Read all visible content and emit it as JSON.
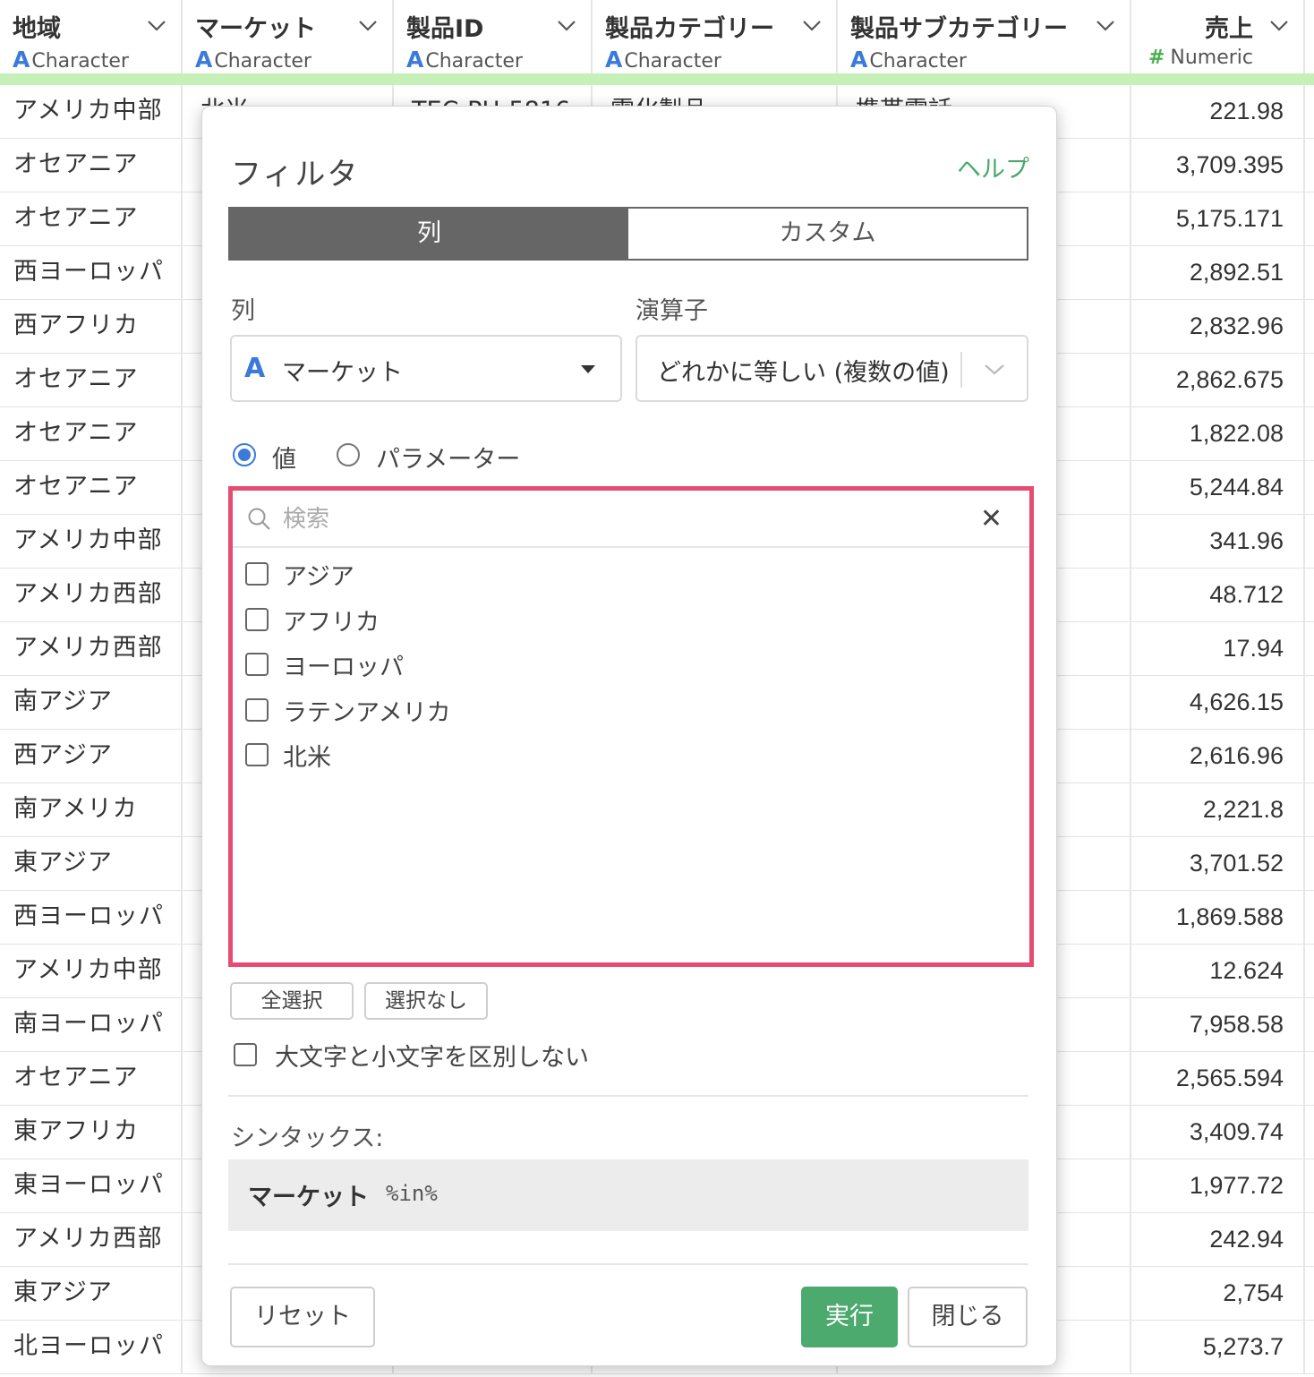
{
  "table": {
    "columns": [
      {
        "name": "地域",
        "type": "Character"
      },
      {
        "name": "マーケット",
        "type": "Character"
      },
      {
        "name": "製品ID",
        "type": "Character"
      },
      {
        "name": "製品カテゴリー",
        "type": "Character"
      },
      {
        "name": "製品サブカテゴリー",
        "type": "Character"
      },
      {
        "name": "売上",
        "type": "Numeric"
      }
    ],
    "type_icons": {
      "character": "A",
      "numeric": "#"
    },
    "first_row_partial": {
      "market": "北米",
      "product_id": "TEC-PH-5816",
      "category": "電化製品",
      "subcategory": "携帯電話"
    },
    "rows": [
      {
        "region": "アメリカ中部",
        "sales": "221.98"
      },
      {
        "region": "オセアニア",
        "sales": "3,709.395"
      },
      {
        "region": "オセアニア",
        "sales": "5,175.171"
      },
      {
        "region": "西ヨーロッパ",
        "sales": "2,892.51"
      },
      {
        "region": "西アフリカ",
        "sales": "2,832.96"
      },
      {
        "region": "オセアニア",
        "sales": "2,862.675"
      },
      {
        "region": "オセアニア",
        "sales": "1,822.08"
      },
      {
        "region": "オセアニア",
        "sales": "5,244.84"
      },
      {
        "region": "アメリカ中部",
        "sales": "341.96"
      },
      {
        "region": "アメリカ西部",
        "sales": "48.712"
      },
      {
        "region": "アメリカ西部",
        "sales": "17.94"
      },
      {
        "region": "南アジア",
        "sales": "4,626.15"
      },
      {
        "region": "西アジア",
        "sales": "2,616.96"
      },
      {
        "region": "南アメリカ",
        "sales": "2,221.8"
      },
      {
        "region": "東アジア",
        "sales": "3,701.52"
      },
      {
        "region": "西ヨーロッパ",
        "sales": "1,869.588"
      },
      {
        "region": "アメリカ中部",
        "sales": "12.624"
      },
      {
        "region": "南ヨーロッパ",
        "sales": "7,958.58"
      },
      {
        "region": "オセアニア",
        "sales": "2,565.594"
      },
      {
        "region": "東アフリカ",
        "sales": "3,409.74"
      },
      {
        "region": "東ヨーロッパ",
        "sales": "1,977.72"
      },
      {
        "region": "アメリカ西部",
        "sales": "242.94"
      },
      {
        "region": "東アジア",
        "sales": "2,754"
      },
      {
        "region": "北ヨーロッパ",
        "sales": "5,273.7"
      }
    ]
  },
  "dialog": {
    "title": "フィルタ",
    "help": "ヘルプ",
    "tabs": {
      "column": "列",
      "custom": "カスタム",
      "active": "column"
    },
    "column_label": "列",
    "operator_label": "演算子",
    "column_value": "マーケット",
    "operator_value": "どれかに等しい (複数の値)",
    "mode": {
      "value": "値",
      "parameter": "パラメーター",
      "selected": "value"
    },
    "search_placeholder": "検索",
    "options": [
      {
        "label": "アジア",
        "checked": false
      },
      {
        "label": "アフリカ",
        "checked": false
      },
      {
        "label": "ヨーロッパ",
        "checked": false
      },
      {
        "label": "ラテンアメリカ",
        "checked": false
      },
      {
        "label": "北米",
        "checked": false
      }
    ],
    "select_all": "全選択",
    "select_none": "選択なし",
    "case_insensitive": "大文字と小文字を区別しない",
    "syntax_label": "シンタックス:",
    "syntax_keyword": "マーケット",
    "syntax_operator": "%in%",
    "reset": "リセット",
    "run": "実行",
    "close": "閉じる"
  },
  "colors": {
    "accent_green": "#4caa6e",
    "highlight_border": "#e74b72",
    "character_type": "#3b7ad9",
    "header_bar": "#c5f0b8"
  }
}
